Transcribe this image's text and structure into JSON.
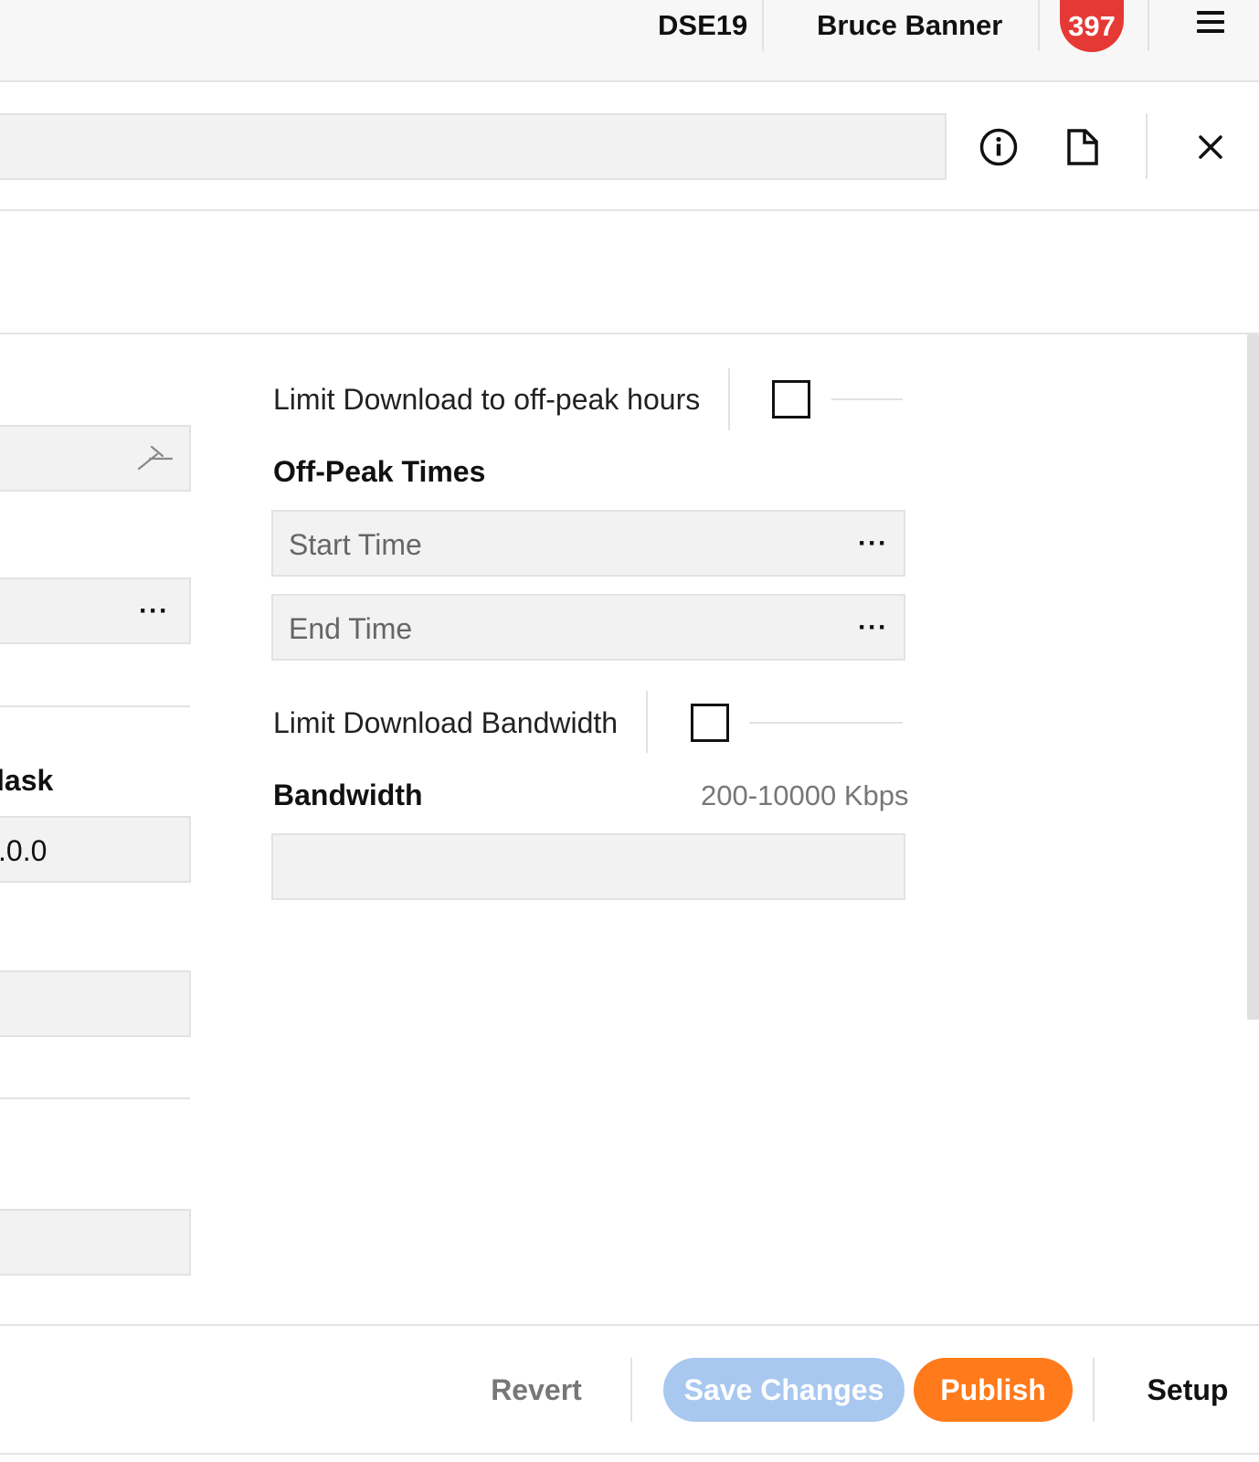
{
  "topbar": {
    "site": "DSE19",
    "user": "Bruce Banner",
    "notifications": "397",
    "menu_icon": "hamburger-menu-icon"
  },
  "header": {
    "info_icon": "info-icon",
    "document_icon": "document-icon",
    "close_icon": "close-icon"
  },
  "left_column": {
    "mask_label_fragment": "lask",
    "mask_value_fragment": ".0.0",
    "field_icon": "arrow-icon"
  },
  "off_peak": {
    "limit_label": "Limit Download to off-peak hours",
    "limit_checked": false,
    "section_title": "Off-Peak Times",
    "start_placeholder": "Start Time",
    "end_placeholder": "End Time"
  },
  "bandwidth": {
    "limit_label": "Limit Download Bandwidth",
    "limit_checked": false,
    "section_title": "Bandwidth",
    "range_hint": "200-10000 Kbps",
    "value": ""
  },
  "footer": {
    "revert": "Revert",
    "save": "Save Changes",
    "publish": "Publish",
    "setup": "Setup"
  },
  "colors": {
    "badge": "#e53935",
    "save_disabled": "#a9c8f0",
    "publish": "#ff7a1a"
  }
}
